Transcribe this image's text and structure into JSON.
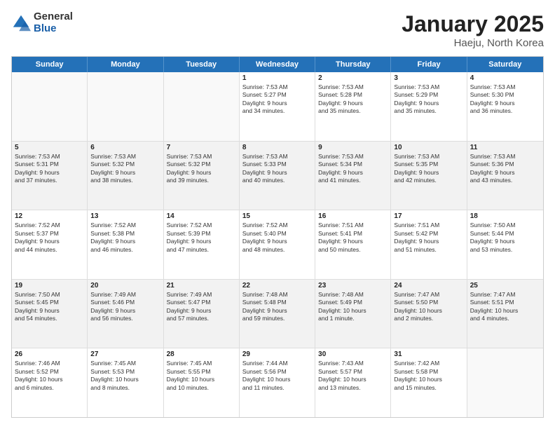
{
  "logo": {
    "general": "General",
    "blue": "Blue"
  },
  "title": {
    "month": "January 2025",
    "location": "Haeju, North Korea"
  },
  "header_days": [
    "Sunday",
    "Monday",
    "Tuesday",
    "Wednesday",
    "Thursday",
    "Friday",
    "Saturday"
  ],
  "weeks": [
    [
      {
        "day": "",
        "info": ""
      },
      {
        "day": "",
        "info": ""
      },
      {
        "day": "",
        "info": ""
      },
      {
        "day": "1",
        "info": "Sunrise: 7:53 AM\nSunset: 5:27 PM\nDaylight: 9 hours\nand 34 minutes."
      },
      {
        "day": "2",
        "info": "Sunrise: 7:53 AM\nSunset: 5:28 PM\nDaylight: 9 hours\nand 35 minutes."
      },
      {
        "day": "3",
        "info": "Sunrise: 7:53 AM\nSunset: 5:29 PM\nDaylight: 9 hours\nand 35 minutes."
      },
      {
        "day": "4",
        "info": "Sunrise: 7:53 AM\nSunset: 5:30 PM\nDaylight: 9 hours\nand 36 minutes."
      }
    ],
    [
      {
        "day": "5",
        "info": "Sunrise: 7:53 AM\nSunset: 5:31 PM\nDaylight: 9 hours\nand 37 minutes."
      },
      {
        "day": "6",
        "info": "Sunrise: 7:53 AM\nSunset: 5:32 PM\nDaylight: 9 hours\nand 38 minutes."
      },
      {
        "day": "7",
        "info": "Sunrise: 7:53 AM\nSunset: 5:32 PM\nDaylight: 9 hours\nand 39 minutes."
      },
      {
        "day": "8",
        "info": "Sunrise: 7:53 AM\nSunset: 5:33 PM\nDaylight: 9 hours\nand 40 minutes."
      },
      {
        "day": "9",
        "info": "Sunrise: 7:53 AM\nSunset: 5:34 PM\nDaylight: 9 hours\nand 41 minutes."
      },
      {
        "day": "10",
        "info": "Sunrise: 7:53 AM\nSunset: 5:35 PM\nDaylight: 9 hours\nand 42 minutes."
      },
      {
        "day": "11",
        "info": "Sunrise: 7:53 AM\nSunset: 5:36 PM\nDaylight: 9 hours\nand 43 minutes."
      }
    ],
    [
      {
        "day": "12",
        "info": "Sunrise: 7:52 AM\nSunset: 5:37 PM\nDaylight: 9 hours\nand 44 minutes."
      },
      {
        "day": "13",
        "info": "Sunrise: 7:52 AM\nSunset: 5:38 PM\nDaylight: 9 hours\nand 46 minutes."
      },
      {
        "day": "14",
        "info": "Sunrise: 7:52 AM\nSunset: 5:39 PM\nDaylight: 9 hours\nand 47 minutes."
      },
      {
        "day": "15",
        "info": "Sunrise: 7:52 AM\nSunset: 5:40 PM\nDaylight: 9 hours\nand 48 minutes."
      },
      {
        "day": "16",
        "info": "Sunrise: 7:51 AM\nSunset: 5:41 PM\nDaylight: 9 hours\nand 50 minutes."
      },
      {
        "day": "17",
        "info": "Sunrise: 7:51 AM\nSunset: 5:42 PM\nDaylight: 9 hours\nand 51 minutes."
      },
      {
        "day": "18",
        "info": "Sunrise: 7:50 AM\nSunset: 5:44 PM\nDaylight: 9 hours\nand 53 minutes."
      }
    ],
    [
      {
        "day": "19",
        "info": "Sunrise: 7:50 AM\nSunset: 5:45 PM\nDaylight: 9 hours\nand 54 minutes."
      },
      {
        "day": "20",
        "info": "Sunrise: 7:49 AM\nSunset: 5:46 PM\nDaylight: 9 hours\nand 56 minutes."
      },
      {
        "day": "21",
        "info": "Sunrise: 7:49 AM\nSunset: 5:47 PM\nDaylight: 9 hours\nand 57 minutes."
      },
      {
        "day": "22",
        "info": "Sunrise: 7:48 AM\nSunset: 5:48 PM\nDaylight: 9 hours\nand 59 minutes."
      },
      {
        "day": "23",
        "info": "Sunrise: 7:48 AM\nSunset: 5:49 PM\nDaylight: 10 hours\nand 1 minute."
      },
      {
        "day": "24",
        "info": "Sunrise: 7:47 AM\nSunset: 5:50 PM\nDaylight: 10 hours\nand 2 minutes."
      },
      {
        "day": "25",
        "info": "Sunrise: 7:47 AM\nSunset: 5:51 PM\nDaylight: 10 hours\nand 4 minutes."
      }
    ],
    [
      {
        "day": "26",
        "info": "Sunrise: 7:46 AM\nSunset: 5:52 PM\nDaylight: 10 hours\nand 6 minutes."
      },
      {
        "day": "27",
        "info": "Sunrise: 7:45 AM\nSunset: 5:53 PM\nDaylight: 10 hours\nand 8 minutes."
      },
      {
        "day": "28",
        "info": "Sunrise: 7:45 AM\nSunset: 5:55 PM\nDaylight: 10 hours\nand 10 minutes."
      },
      {
        "day": "29",
        "info": "Sunrise: 7:44 AM\nSunset: 5:56 PM\nDaylight: 10 hours\nand 11 minutes."
      },
      {
        "day": "30",
        "info": "Sunrise: 7:43 AM\nSunset: 5:57 PM\nDaylight: 10 hours\nand 13 minutes."
      },
      {
        "day": "31",
        "info": "Sunrise: 7:42 AM\nSunset: 5:58 PM\nDaylight: 10 hours\nand 15 minutes."
      },
      {
        "day": "",
        "info": ""
      }
    ]
  ]
}
